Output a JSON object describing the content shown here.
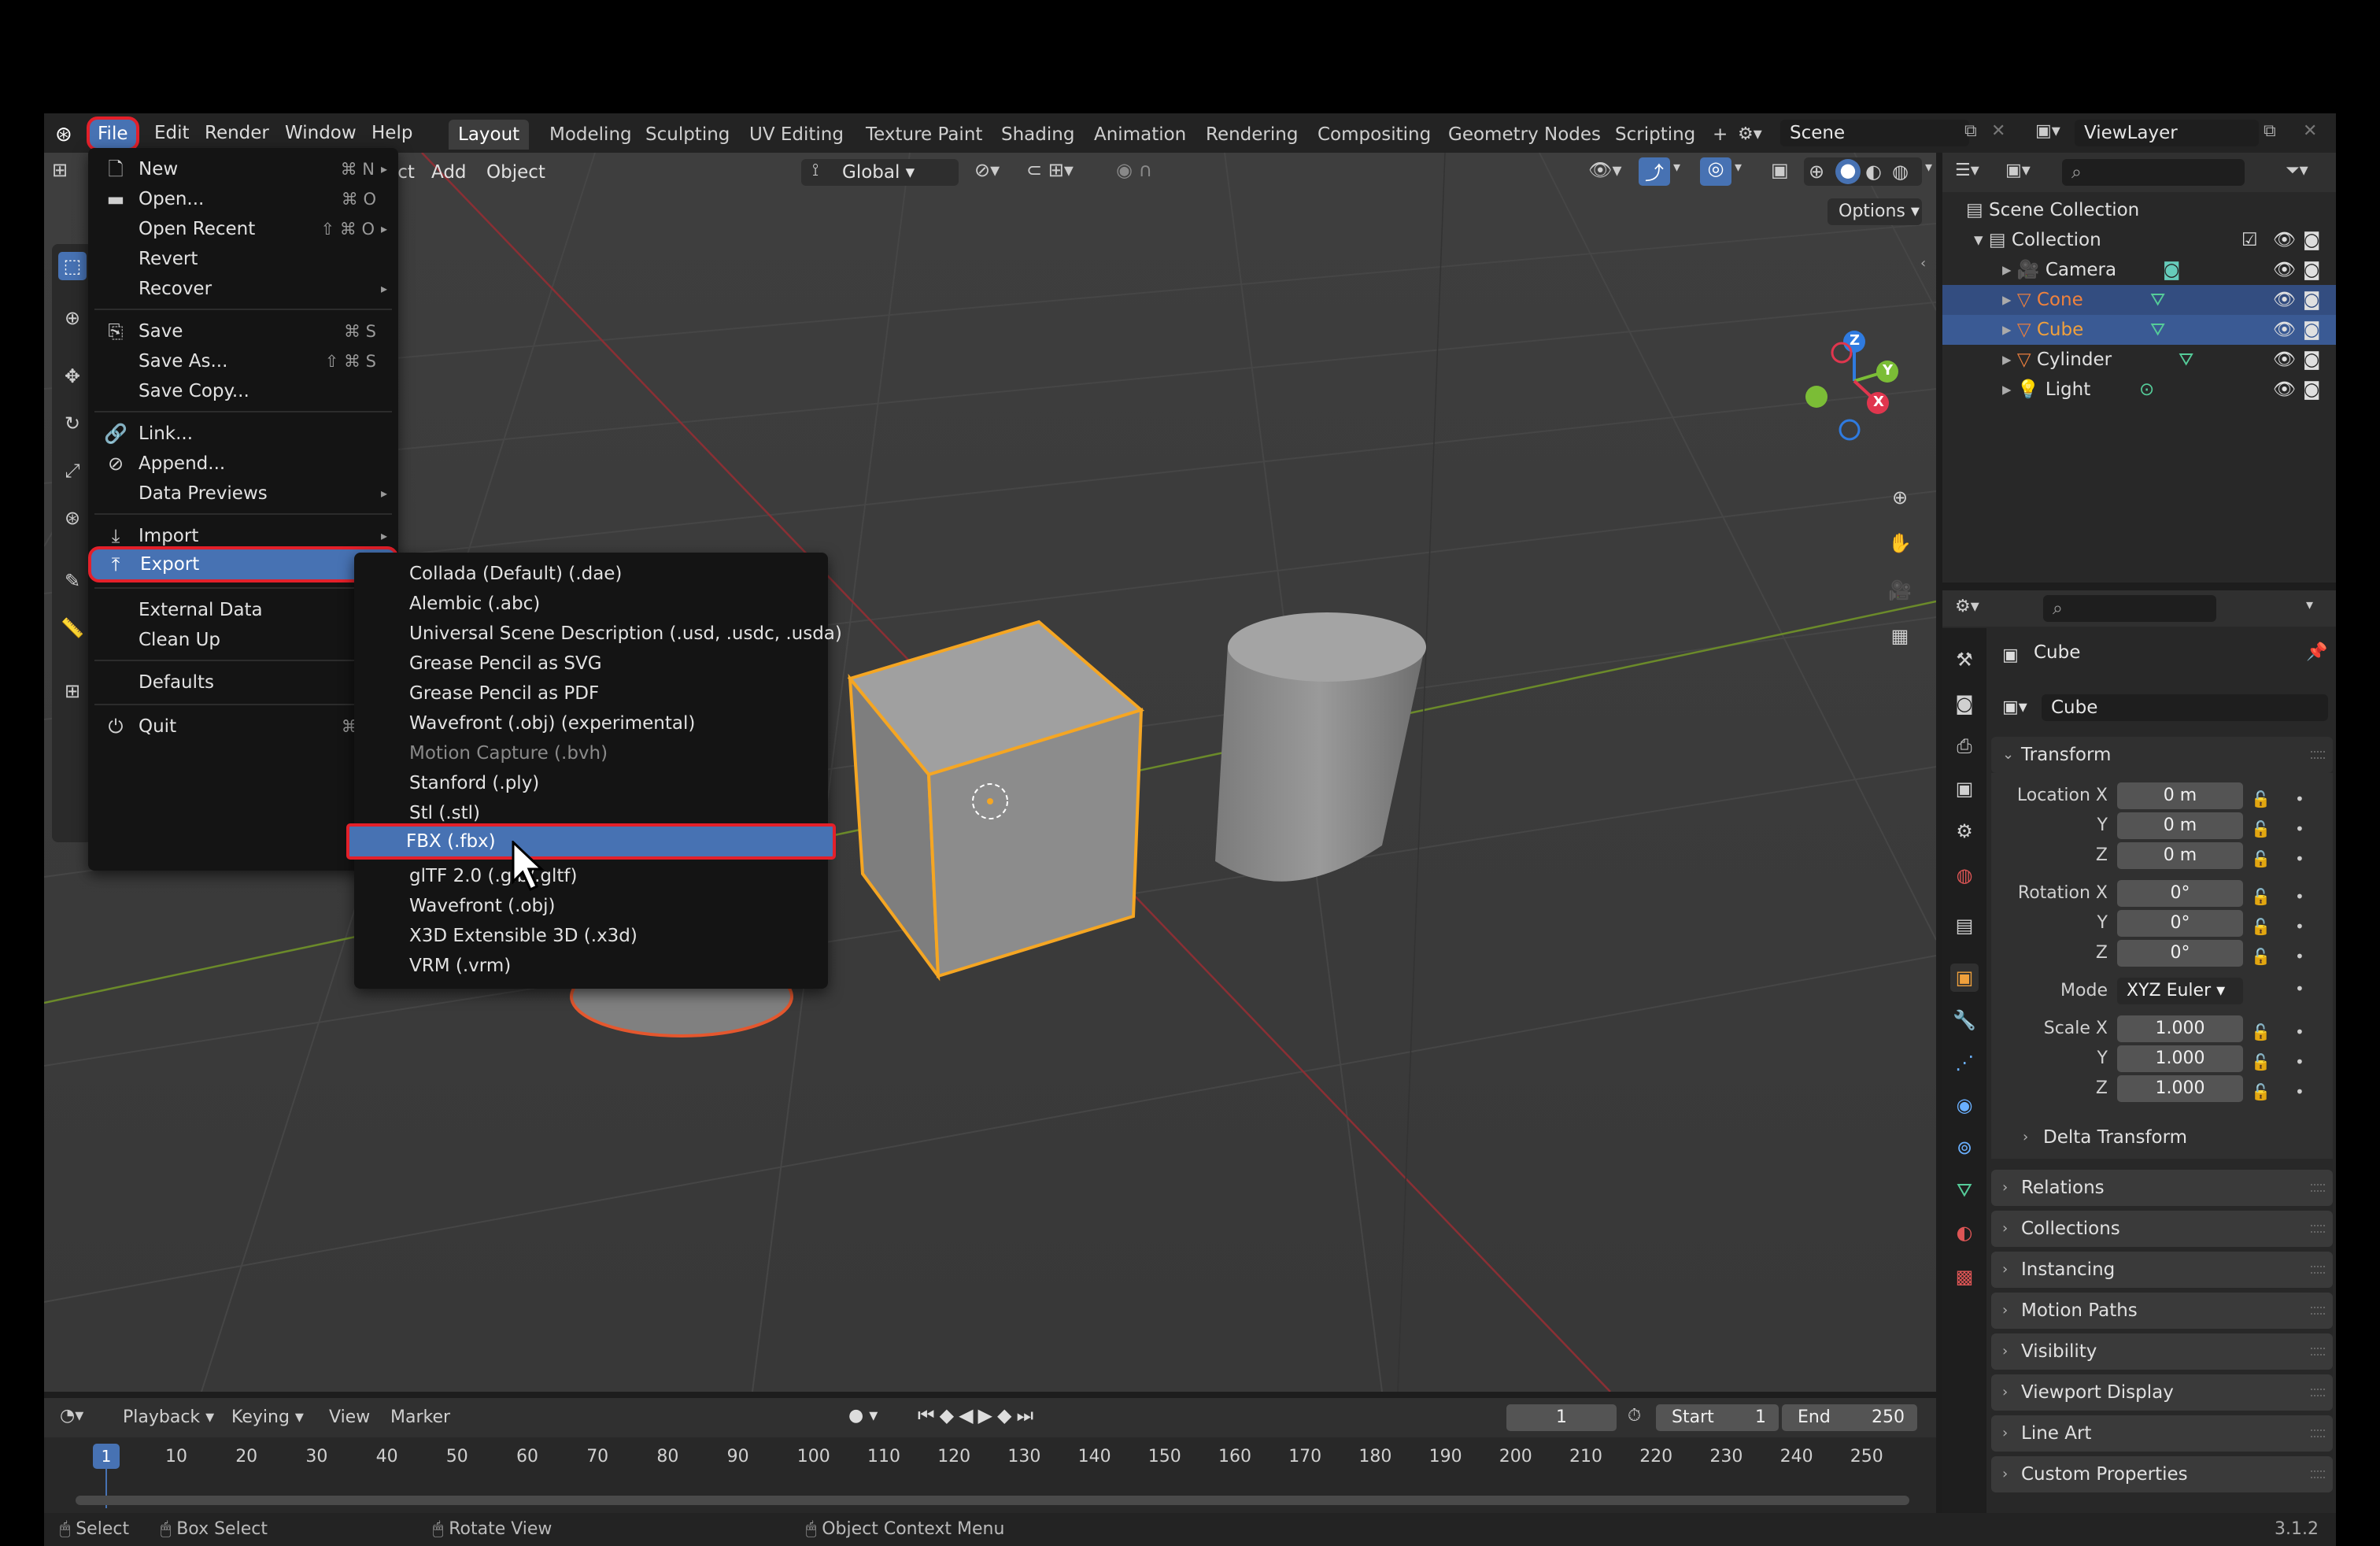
{
  "menubar": {
    "file": "File",
    "edit": "Edit",
    "render": "Render",
    "window": "Window",
    "help": "Help",
    "workspaces": [
      "Layout",
      "Modeling",
      "Sculpting",
      "UV Editing",
      "Texture Paint",
      "Shading",
      "Animation",
      "Rendering",
      "Compositing",
      "Geometry Nodes",
      "Scripting"
    ],
    "add_tab": "+",
    "scene": "Scene",
    "view_layer": "ViewLayer"
  },
  "viewport_header": {
    "select": "Select",
    "add": "Add",
    "object": "Object",
    "orientation": "Global",
    "options": "Options"
  },
  "file_menu": {
    "items": [
      {
        "label": "New",
        "shortcut": "⌘ N",
        "arrow": true
      },
      {
        "label": "Open...",
        "shortcut": "⌘ O"
      },
      {
        "label": "Open Recent",
        "shortcut": "⇧ ⌘ O",
        "arrow": true
      },
      {
        "label": "Revert"
      },
      {
        "label": "Recover",
        "arrow": true
      },
      {
        "label": "Save",
        "shortcut": "⌘ S"
      },
      {
        "label": "Save As...",
        "shortcut": "⇧ ⌘ S"
      },
      {
        "label": "Save Copy..."
      },
      {
        "label": "Link..."
      },
      {
        "label": "Append..."
      },
      {
        "label": "Data Previews",
        "arrow": true
      },
      {
        "label": "Import",
        "arrow": true
      },
      {
        "label": "Export",
        "arrow": true
      },
      {
        "label": "External Data",
        "arrow": true
      },
      {
        "label": "Clean Up",
        "arrow": true
      },
      {
        "label": "Defaults",
        "arrow": true
      },
      {
        "label": "Quit",
        "shortcut": "⌘ Q"
      }
    ]
  },
  "export_menu": {
    "items": [
      "Collada (Default) (.dae)",
      "Alembic (.abc)",
      "Universal Scene Description (.usd, .usdc, .usda)",
      "Grease Pencil as SVG",
      "Grease Pencil as PDF",
      "Wavefront (.obj) (experimental)",
      "Motion Capture (.bvh)",
      "Stanford (.ply)",
      "Stl (.stl)",
      "FBX (.fbx)",
      "glTF 2.0 (.glb/.gltf)",
      "Wavefront (.obj)",
      "X3D Extensible 3D (.x3d)",
      "VRM (.vrm)"
    ],
    "selected": "FBX (.fbx)",
    "disabled": "Motion Capture (.bvh)"
  },
  "outliner": {
    "scene_collection": "Scene Collection",
    "collection": "Collection",
    "objects": [
      {
        "name": "Camera",
        "color": "#e0e0e0"
      },
      {
        "name": "Cone",
        "color": "#f0823c"
      },
      {
        "name": "Cube",
        "color": "#f0a03c"
      },
      {
        "name": "Cylinder",
        "color": "#e0e0e0"
      },
      {
        "name": "Light",
        "color": "#e0e0e0"
      }
    ]
  },
  "properties": {
    "object_name": "Cube",
    "data_name": "Cube",
    "transform_label": "Transform",
    "location_label": "Location X",
    "rotation_label": "Rotation X",
    "scale_label": "Scale X",
    "y": "Y",
    "z": "Z",
    "location": [
      "0 m",
      "0 m",
      "0 m"
    ],
    "rotation": [
      "0°",
      "0°",
      "0°"
    ],
    "mode_label": "Mode",
    "mode": "XYZ Euler",
    "scale": [
      "1.000",
      "1.000",
      "1.000"
    ],
    "delta": "Delta Transform",
    "sections": [
      "Relations",
      "Collections",
      "Instancing",
      "Motion Paths",
      "Visibility",
      "Viewport Display",
      "Line Art",
      "Custom Properties"
    ]
  },
  "timeline": {
    "playback": "Playback",
    "keying": "Keying",
    "view": "View",
    "marker": "Marker",
    "current_frame": "1",
    "start_label": "Start",
    "start": "1",
    "end_label": "End",
    "end": "250",
    "ruler": [
      "10",
      "20",
      "30",
      "40",
      "50",
      "60",
      "70",
      "80",
      "90",
      "100",
      "110",
      "120",
      "130",
      "140",
      "150",
      "160",
      "170",
      "180",
      "190",
      "200",
      "210",
      "220",
      "230",
      "240",
      "250"
    ],
    "frame_marker": "1"
  },
  "statusbar": {
    "select": "Select",
    "box_select": "Box Select",
    "rotate_view": "Rotate View",
    "context_menu": "Object Context Menu",
    "version": "3.1.2"
  },
  "gizmo": {
    "x": "X",
    "y": "Y",
    "z": "Z"
  }
}
